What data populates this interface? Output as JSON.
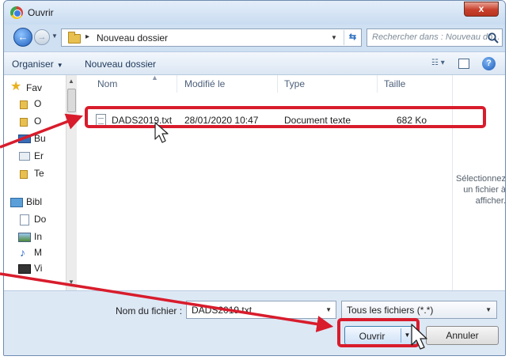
{
  "window": {
    "title": "Ouvrir",
    "close_glyph": "x",
    "app_icon": "chrome-icon"
  },
  "address": {
    "path_arrow": "▸",
    "path": "Nouveau dossier",
    "search_placeholder": "Rechercher dans : Nouveau do..."
  },
  "toolbar": {
    "organize": "Organiser",
    "new_folder": "Nouveau dossier",
    "help": "?"
  },
  "nav": {
    "items": [
      {
        "label": "Fav",
        "icon": "star-icon"
      },
      {
        "label": "O",
        "icon": "folder-icon"
      },
      {
        "label": "O",
        "icon": "folder-icon"
      },
      {
        "label": "Bu",
        "icon": "desktop-icon"
      },
      {
        "label": "Er",
        "icon": "network-icon"
      },
      {
        "label": "Te",
        "icon": "folder-icon"
      },
      {
        "label": "Bibl",
        "icon": "library-icon"
      },
      {
        "label": "Do",
        "icon": "documents-icon"
      },
      {
        "label": "In",
        "icon": "images-icon"
      },
      {
        "label": "M",
        "icon": "music-icon"
      },
      {
        "label": "Vi",
        "icon": "videos-icon"
      }
    ]
  },
  "columns": {
    "name": "Nom",
    "modified": "Modifié le",
    "type": "Type",
    "size": "Taille"
  },
  "files": [
    {
      "name": "DADS2019.txt",
      "modified": "28/01/2020 10:47",
      "type": "Document texte",
      "size": "682 Ko"
    }
  ],
  "preview": {
    "line1": "Sélectionnez",
    "line2": "un fichier à",
    "line3": "afficher."
  },
  "footer": {
    "filename_label": "Nom du fichier :",
    "filename_value": "DADS2019.txt",
    "filetype": "Tous les fichiers (*.*)",
    "open": "Ouvrir",
    "cancel": "Annuler"
  },
  "annotation": {
    "highlight_color": "#d81c2c"
  }
}
